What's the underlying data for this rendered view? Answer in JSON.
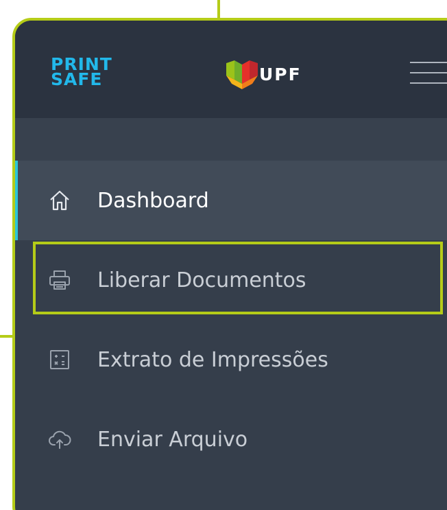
{
  "brand": {
    "printsafe_line1": "PRINT",
    "printsafe_line2": "SAFE",
    "upf_text": "UPF"
  },
  "nav": {
    "items": [
      {
        "label": "Dashboard",
        "icon": "home-icon",
        "active": true
      },
      {
        "label": "Liberar Documentos",
        "icon": "printer-icon",
        "highlighted": true
      },
      {
        "label": "Extrato de Impressões",
        "icon": "calculator-icon"
      },
      {
        "label": "Enviar Arquivo",
        "icon": "cloud-upload-icon"
      }
    ]
  },
  "colors": {
    "callout_accent": "#b5cc18",
    "sidebar_bg": "#353e4b",
    "header_bg": "#2b3340",
    "active_bg": "#414b58",
    "active_indicator": "#2ec4d6",
    "printsafe_blue": "#22b8ea"
  }
}
